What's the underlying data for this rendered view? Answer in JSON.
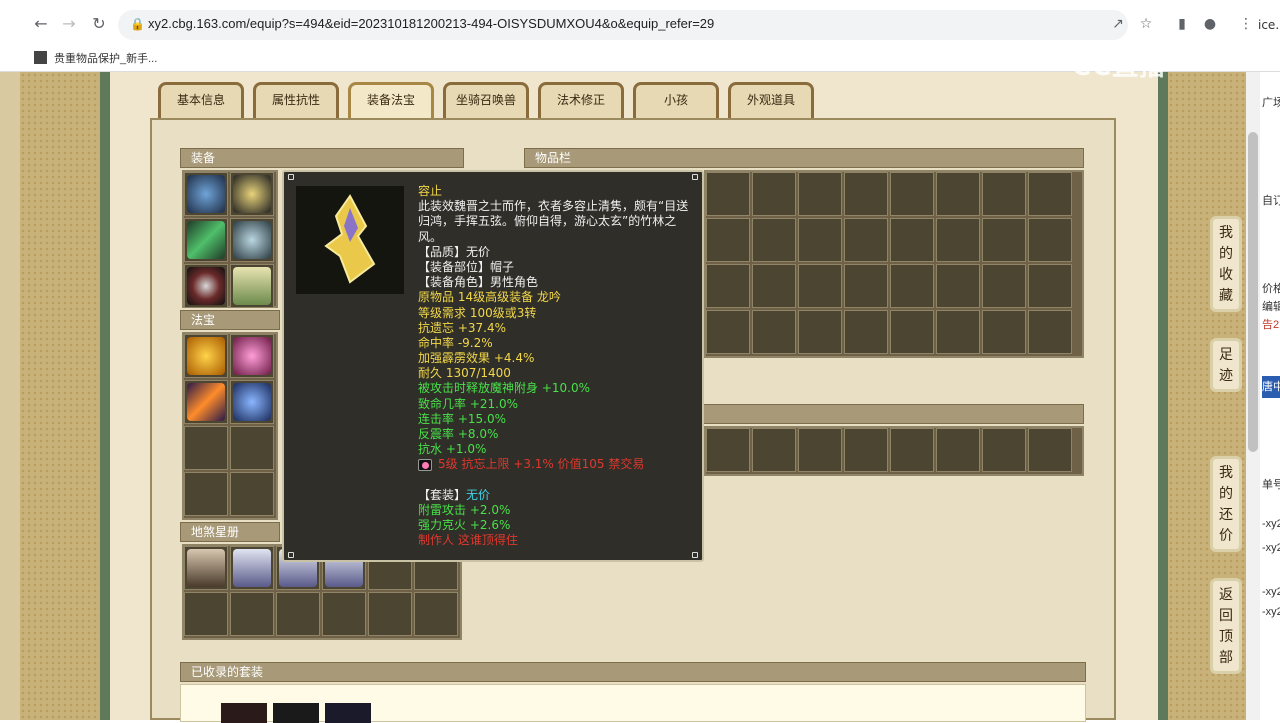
{
  "browser": {
    "url": "xy2.cbg.163.com/equip?s=494&eid=202310181200213-494-OISYSDUMXOU4&o&equip_refer=29",
    "url_tail": "ice.",
    "bookmark": "贵重物品保护_新手...",
    "watermark": "CC直播"
  },
  "tabs": [
    "基本信息",
    "属性抗性",
    "装备法宝",
    "坐骑召唤兽",
    "法术修正",
    "小孩",
    "外观道具"
  ],
  "active_tab": 2,
  "sections": {
    "equip": "装备",
    "inventory": "物品栏",
    "treasure": "法宝",
    "stars": "地煞星册",
    "sets": "已收录的套装"
  },
  "tooltip": {
    "lines": [
      {
        "text": "容止",
        "color": "#f2d84a"
      },
      {
        "text": "此装效魏晋之士而作，衣者多容止清隽，颇有“目送",
        "color": "#f0f0f0"
      },
      {
        "text": "归鸿，手挥五弦。俯仰自得，游心太玄”的竹林之",
        "color": "#f0f0f0"
      },
      {
        "text": "风。",
        "color": "#f0f0f0"
      },
      {
        "text": "【品质】无价",
        "color": "#f0f0f0"
      },
      {
        "text": "【装备部位】帽子",
        "color": "#f0f0f0"
      },
      {
        "text": "【装备角色】男性角色",
        "color": "#f0f0f0"
      },
      {
        "text": "原物品 14级高级装备 龙吟",
        "color": "#f2d84a"
      },
      {
        "text": "等级需求 100级或3转",
        "color": "#f2d84a"
      },
      {
        "text": "抗遗忘 +37.4%",
        "color": "#f2d84a"
      },
      {
        "text": "命中率 -9.2%",
        "color": "#f2d84a"
      },
      {
        "text": "加强霹雳效果 +4.4%",
        "color": "#f2d84a"
      },
      {
        "text": "耐久 1307/1400",
        "color": "#f2d84a"
      },
      {
        "text": "被攻击时释放魔神附身 +10.0%",
        "color": "#49e04a"
      },
      {
        "text": "致命几率 +21.0%",
        "color": "#49e04a"
      },
      {
        "text": "连击率 +15.0%",
        "color": "#49e04a"
      },
      {
        "text": "反震率 +8.0%",
        "color": "#49e04a"
      },
      {
        "text": "抗水 +1.0%",
        "color": "#49e04a"
      },
      {
        "text": "5级 抗忘上限 +3.1% 价值105 禁交易",
        "color": "#e0382e",
        "gem": true
      },
      {
        "text": "",
        "color": "#f0f0f0"
      },
      {
        "text": "【套装】无价",
        "color": "#f0f0f0",
        "accent": "无价"
      },
      {
        "text": "附雷攻击 +2.0%",
        "color": "#49e04a"
      },
      {
        "text": "强力克火 +2.6%",
        "color": "#49e04a"
      },
      {
        "text": "制作人 这谁顶得住",
        "color": "#e0382e"
      }
    ]
  },
  "side_buttons": [
    "我的收藏",
    "足迹",
    "我的还价",
    "返回顶部"
  ],
  "right_cut_text": [
    "广场",
    "自订",
    "价格",
    "编辑",
    "告2",
    "唐中",
    "单号",
    "-xy2",
    "-xy2",
    "-xy2",
    "-xy2"
  ],
  "colors": {
    "accent_yellow": "#f2d84a",
    "accent_green": "#49e04a",
    "accent_red": "#e0382e",
    "set_name": "#3fd3e8"
  },
  "icons": [
    "back-icon",
    "forward-icon",
    "reload-icon",
    "lock-icon",
    "share-icon",
    "star-icon",
    "sidepanel-icon",
    "profile-icon",
    "menu-icon"
  ]
}
